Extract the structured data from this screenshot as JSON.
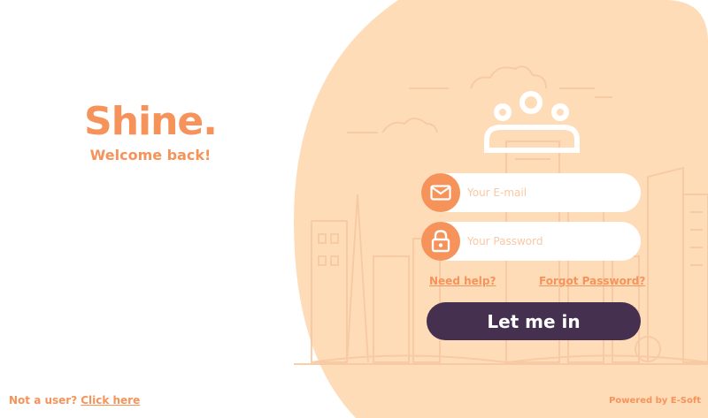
{
  "brand": {
    "title": "Shine.",
    "subtitle": "Welcome back!"
  },
  "form": {
    "email_placeholder": "Your E-mail",
    "password_placeholder": "Your Password",
    "need_help": "Need help?",
    "forgot_password": "Forgot Password?",
    "submit_label": "Let me in"
  },
  "footer": {
    "signup_prompt": "Not a user?",
    "signup_link": "Click here",
    "powered_by": "Powered by E-Soft"
  },
  "icons": [
    "users-group-icon",
    "envelope-icon",
    "lock-icon"
  ],
  "colors": {
    "accent": "#f5935a",
    "panel": "#fedcb8",
    "button": "#45304f"
  }
}
